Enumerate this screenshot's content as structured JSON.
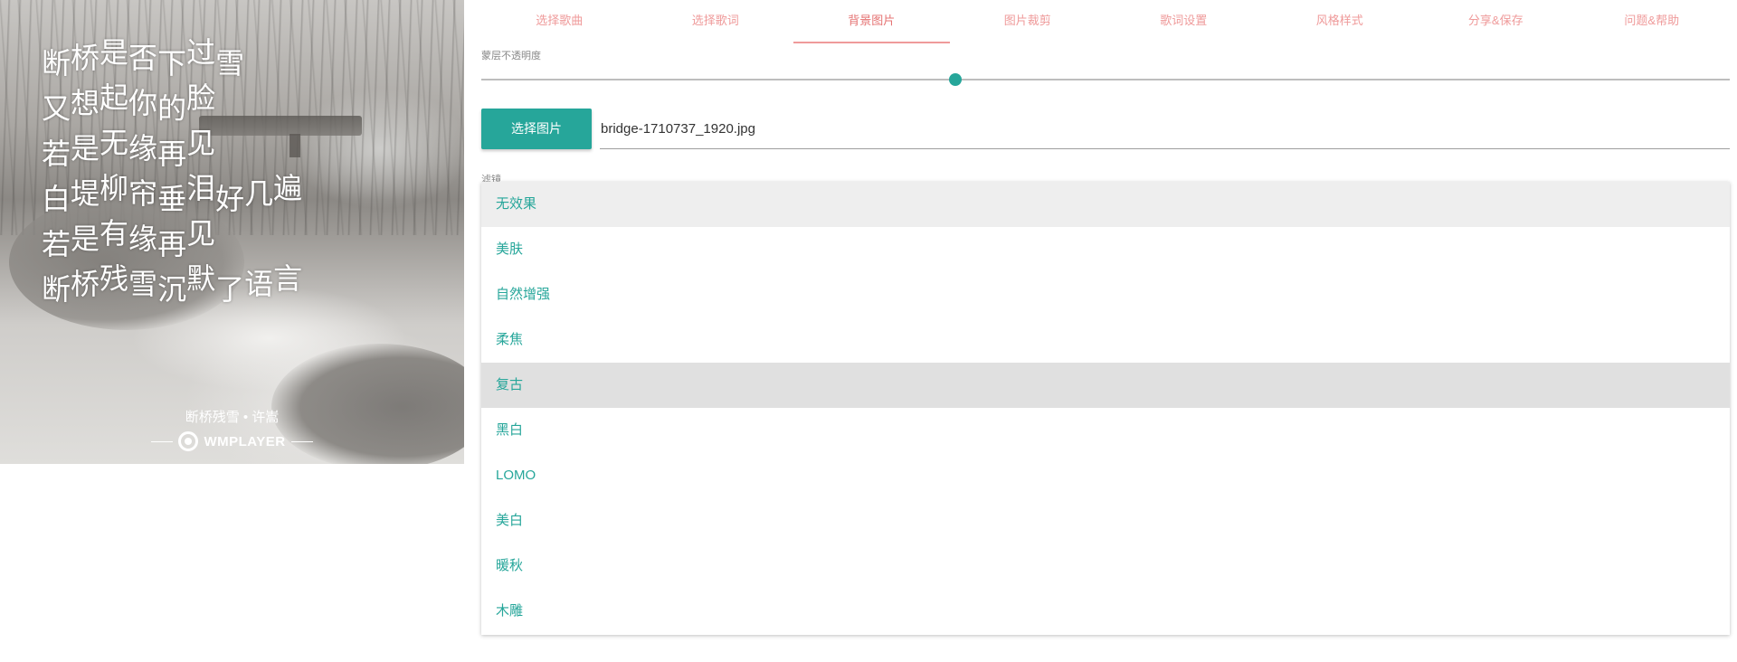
{
  "preview": {
    "lyrics": [
      [
        "断",
        "桥",
        "是",
        "否",
        "下",
        "过",
        "雪"
      ],
      [
        "又",
        "想",
        "起",
        "你",
        "的",
        "脸"
      ],
      [
        "若",
        "是",
        "无",
        "缘",
        "再",
        "见"
      ],
      [
        "白",
        "堤",
        "柳",
        "帘",
        "垂",
        "泪",
        "好",
        "几",
        "遍"
      ],
      [
        "若",
        "是",
        "有",
        "缘",
        "再",
        "见"
      ],
      [
        "断",
        "桥",
        "残",
        "雪",
        "沉",
        "默",
        "了",
        "语",
        "言"
      ]
    ],
    "credit": "断桥残雪 • 许嵩",
    "brand": "WMPLAYER"
  },
  "tabs": [
    {
      "label": "选择歌曲",
      "active": false
    },
    {
      "label": "选择歌词",
      "active": false
    },
    {
      "label": "背景图片",
      "active": true
    },
    {
      "label": "图片裁剪",
      "active": false
    },
    {
      "label": "歌词设置",
      "active": false
    },
    {
      "label": "风格样式",
      "active": false
    },
    {
      "label": "分享&保存",
      "active": false
    },
    {
      "label": "问题&帮助",
      "active": false
    }
  ],
  "opacity": {
    "label": "蒙层不透明度",
    "value": 0.38
  },
  "file": {
    "button_label": "选择图片",
    "filename": "bridge-1710737_1920.jpg"
  },
  "filter": {
    "label": "滤镜",
    "selected_index": 0,
    "hovered_index": 4,
    "options": [
      "无效果",
      "美肤",
      "自然增强",
      "柔焦",
      "复古",
      "黑白",
      "LOMO",
      "美白",
      "暖秋",
      "木雕"
    ]
  },
  "colors": {
    "accent": "#26a69a",
    "tab_text": "#ef9a9a",
    "tab_active": "#e57373"
  }
}
